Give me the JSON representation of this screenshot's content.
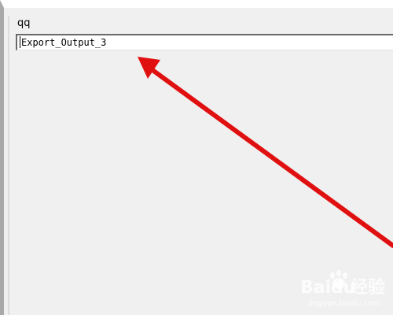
{
  "form": {
    "label": "qq",
    "input_value": "Export_Output_3"
  },
  "annotation": {
    "arrow_color": "#e01010",
    "arrow_icon": "red-arrow-icon"
  },
  "watermark": {
    "brand": "Baidu",
    "product": "经验",
    "url": "jingyan.baidu.com"
  },
  "colors": {
    "background": "#f0f0f0",
    "input_background": "#ffffff",
    "annotation": "#e01010"
  }
}
